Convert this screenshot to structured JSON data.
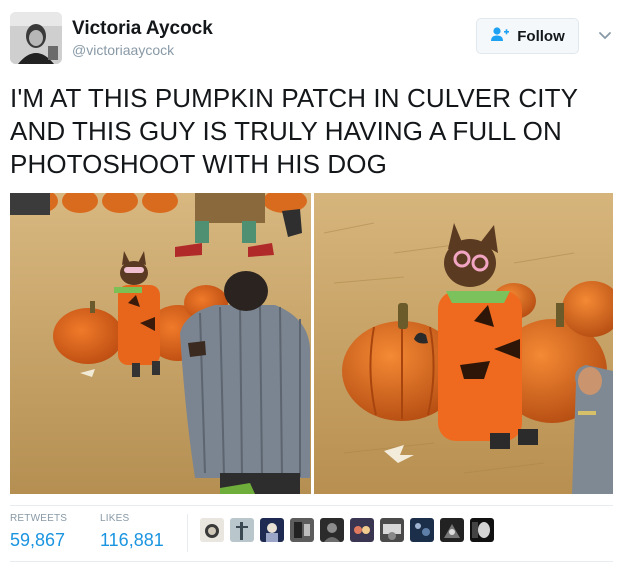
{
  "user": {
    "name": "Victoria Aycock",
    "handle": "@victoriaaycock"
  },
  "follow_button": {
    "label": "Follow"
  },
  "tweet": {
    "lines": [
      "I'M AT THIS PUMPKIN PATCH IN CULVER CITY",
      "AND THIS GUY IS TRULY HAVING A FULL ON",
      "PHOTOSHOOT WITH HIS DOG"
    ]
  },
  "stats": {
    "retweets_label": "RETWEETS",
    "retweets_value": "59,867",
    "likes_label": "LIKES",
    "likes_value": "116,881"
  },
  "colors": {
    "link_blue": "#1b95e0",
    "pumpkin_orange": "#e36a1c",
    "hay": "#c9a262"
  },
  "icons": {
    "follow": "add-person-icon",
    "menu": "chevron-down-icon"
  }
}
